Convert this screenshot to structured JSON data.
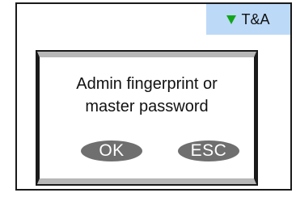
{
  "status": {
    "icon": "triangle-down-icon",
    "label": "T&A",
    "icon_color": "#12a51b",
    "background_color": "#bcd9f7"
  },
  "dialog": {
    "message": "Admin fingerprint or\nmaster password",
    "ok_label": "OK",
    "esc_label": "ESC"
  }
}
